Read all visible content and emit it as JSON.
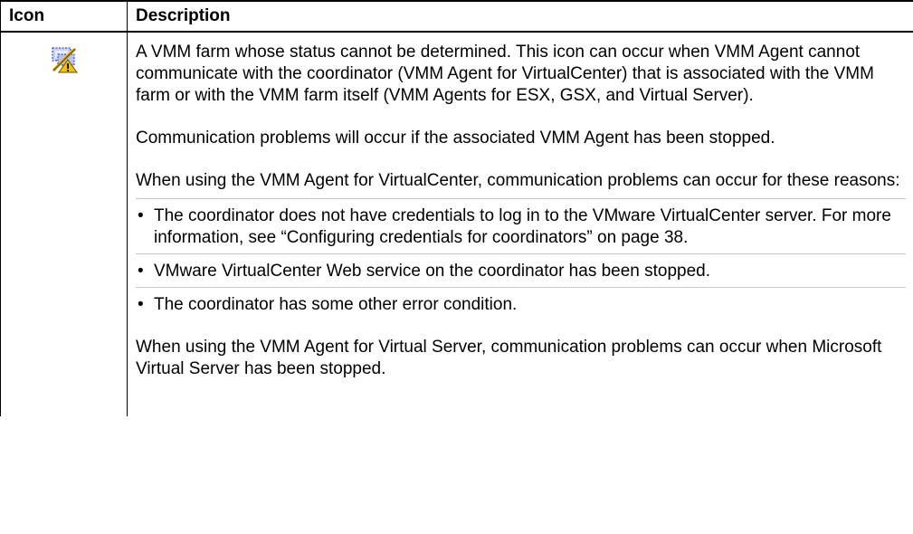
{
  "table": {
    "headers": {
      "icon": "Icon",
      "description": "Description"
    },
    "row": {
      "icon_name": "vmm-farm-unknown-status-icon",
      "para1": "A VMM farm whose status cannot be determined. This icon can occur when VMM Agent cannot communicate with the coordinator (VMM Agent for VirtualCenter) that is associated with the VMM farm or with the VMM farm itself (VMM Agents for ESX, GSX, and Virtual Server).",
      "para2": "Communication problems will occur if the associated VMM Agent has been stopped.",
      "para3": "When using the VMM Agent for VirtualCenter, communication problems can occur for these reasons:",
      "bullets": [
        "The coordinator does not have credentials to log in to the VMware VirtualCenter server. For more information, see “Configuring credentials for coordinators” on page 38.",
        "VMware VirtualCenter Web service on the coordinator has been stopped.",
        "The coordinator has some other error condition."
      ],
      "bullet_mark": "•",
      "para4": "When using the VMM Agent for Virtual Server, communication problems can occur when Microsoft Virtual Server has been stopped."
    }
  }
}
